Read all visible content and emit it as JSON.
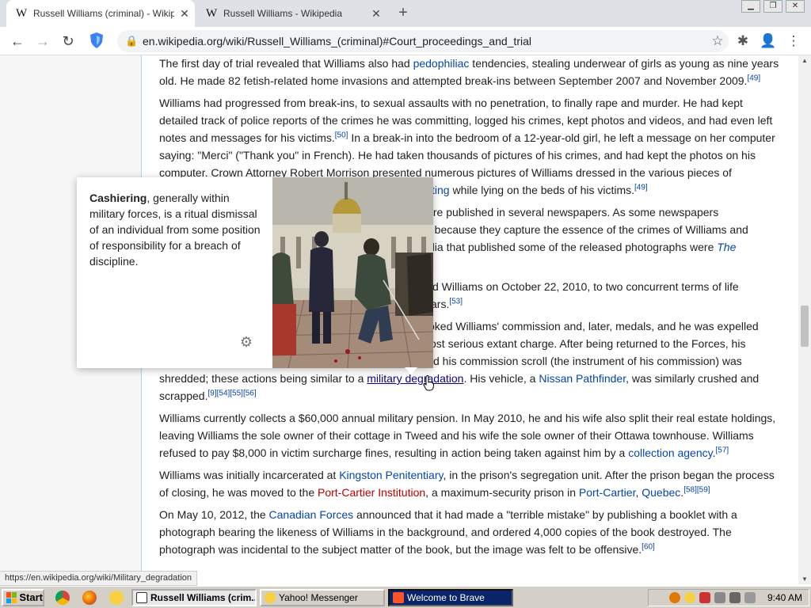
{
  "tabs": [
    {
      "favicon": "W",
      "title": "Russell Williams (criminal) - Wikipedia",
      "close": "✕"
    },
    {
      "favicon": "W",
      "title": "Russell Williams - Wikipedia",
      "close": "✕"
    }
  ],
  "new_tab": "+",
  "window_controls": {
    "minimize": "▁",
    "restore": "❐",
    "close": "✕"
  },
  "toolbar": {
    "back": "←",
    "forward": "→",
    "reload": "↻",
    "lock": "🔒",
    "url": "en.wikipedia.org/wiki/Russell_Williams_(criminal)#Court_proceedings_and_trial",
    "star": "☆",
    "extensions": "✱",
    "profile": "👤",
    "menu": "⋮"
  },
  "article": {
    "p1": {
      "t1": "The first day of trial revealed that Williams also had ",
      "l1": "pedophiliac",
      "t2": " tendencies, stealing underwear of girls as young as nine years old. He made 82 fetish-related home invasions and attempted break-ins between September 2007 and November 2009.",
      "r1": "[49]"
    },
    "p2": {
      "t1": "Williams had progressed from break-ins, to sexual assaults with no penetration, to finally rape and murder. He had kept detailed track of police reports of the crimes he was committing, logged his crimes, kept photos and videos, and had even left notes and messages for his victims.",
      "r1": "[50]",
      "t2": " In a break-in into the bedroom of a 12-year-old girl, he left a message on her computer saying: \"Merci\" (\"Thank you\" in French). He had taken thousands of pictures of his crimes, and had kept the photos on his computer. Crown Attorney Robert Morrison presented numerous pictures of Williams dressed in the various pieces of",
      "t3": "ting",
      "t4": " while lying on the beds of his victims.",
      "r2": "[49]"
    },
    "p3": {
      "t1": "were published in several newspapers. As some newspapers",
      "t2": "d because they capture the essence of the crimes of Williams and",
      "t3": "dia that published some of the released photographs were ",
      "i1": "The"
    },
    "p4": {
      "t1": "d Williams on October 22, 2010, to two concurrent terms of life",
      "t2": "ars.",
      "r1": "[53]"
    },
    "p5": {
      "t1": "oked Williams' commission and, later, medals, and he was expelled",
      "t2": "ost serious extant charge. After being returned to the Forces, his",
      "t3": "d his commission scroll (the instrument of his commission) was",
      "t4": "shredded; these actions being similar to a ",
      "l1": "military degradation",
      "t5": ". His vehicle, a ",
      "l2": "Nissan Pathfinder",
      "t6": ", was similarly crushed and scrapped.",
      "r1": "[9][54][55][56]"
    },
    "p6": {
      "t1": "Williams currently collects a $60,000 annual military pension. In May 2010, he and his wife also split their real estate holdings, leaving Williams the sole owner of their cottage in Tweed and his wife the sole owner of their Ottawa townhouse. Williams refused to pay $8,000 in victim surcharge fines, resulting in action being taken against him by a ",
      "l1": "collection agency",
      "t2": ".",
      "r1": "[57]"
    },
    "p7": {
      "t1": "Williams was initially incarcerated at ",
      "l1": "Kingston Penitentiary",
      "t2": ", in the prison's segregation unit. After the prison began the process of closing, he was moved to the ",
      "l2": "Port-Cartier Institution",
      "t3": ", a maximum-security prison in ",
      "l3": "Port-Cartier",
      "t4": ", ",
      "l4": "Quebec",
      "t5": ".",
      "r1": "[58][59]"
    },
    "p8": {
      "t1": "On May 10, 2012, the ",
      "l1": "Canadian Forces",
      "t2": " announced that it had made a \"terrible mistake\" by publishing a booklet with a photograph bearing the likeness of Williams in the background, and ordered 4,000 copies of the book destroyed. The photograph was incidental to the subject matter of the book, but the image was felt to be offensive.",
      "r1": "[60]"
    }
  },
  "popup": {
    "term": "Cashiering",
    "text": ", generally within military forces, is a ritual dismissal of an individual from some position of responsibility for a breach of discipline.",
    "gear": "⚙"
  },
  "status_url": "https://en.wikipedia.org/wiki/Military_degradation",
  "taskbar": {
    "start": "Start",
    "tasks": [
      {
        "label": "Russell Williams (crim..."
      },
      {
        "label": "Yahoo! Messenger"
      },
      {
        "label": "Welcome to Brave"
      }
    ],
    "clock": "9:40 AM"
  }
}
